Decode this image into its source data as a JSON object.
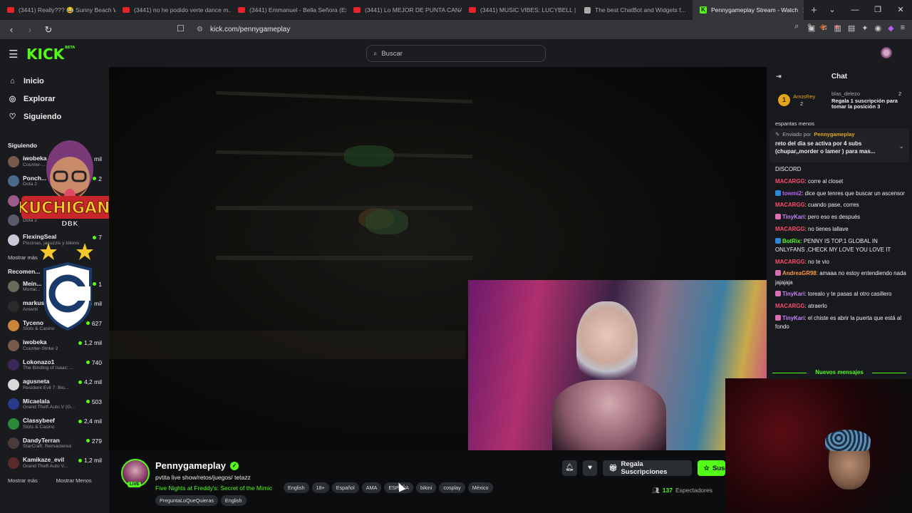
{
  "browser": {
    "tabs": [
      {
        "label": "(3441) Really??? 😂 Sunny Beach W...",
        "icon": "youtube"
      },
      {
        "label": "(3441) no he podido verte dance m...",
        "icon": "youtube"
      },
      {
        "label": "(3441) Emmanuel - Bella Señora (Ext...",
        "icon": "youtube"
      },
      {
        "label": "(3441) Lo MEJOR DE PUNTA CANA |",
        "icon": "youtube"
      },
      {
        "label": "(3441) MUSIC VIBES: LUCYBELL | by...",
        "icon": "youtube"
      },
      {
        "label": "The best ChatBot and Widgets f...",
        "icon": "generic"
      },
      {
        "label": "Pennygameplay Stream - Watch",
        "icon": "kick",
        "active": true
      }
    ],
    "new_tab": "+",
    "url": "kick.com/pennygameplay"
  },
  "topbar": {
    "logo": "KICK",
    "logo_badge": "BETA",
    "search_placeholder": "Buscar"
  },
  "sidebar": {
    "nav": [
      {
        "label": "Inicio",
        "icon": "home-icon"
      },
      {
        "label": "Explorar",
        "icon": "compass-icon"
      },
      {
        "label": "Siguiendo",
        "icon": "heart-icon"
      }
    ],
    "following_title": "Siguiendo",
    "following": [
      {
        "name": "iwobeka",
        "game": "Counter-...",
        "viewers": "mil",
        "color": "#7a5a4a"
      },
      {
        "name": "Ponch...",
        "game": "Dota 2",
        "viewers": "2",
        "color": "#4a6a8a"
      },
      {
        "name": "",
        "game": "",
        "viewers": "",
        "color": "#9a5a8a"
      },
      {
        "name": "",
        "game": "Dota 2",
        "viewers": "",
        "color": "#5a5a6a"
      },
      {
        "name": "FlexingSeal",
        "game": "Piscinas, jacuzzis y bikinis",
        "viewers": "7",
        "color": "#c9c9d9"
      }
    ],
    "following_more": "Mostrar más",
    "recommended_title": "Recomen...",
    "recommended": [
      {
        "name": "Mein...",
        "game": "Mortal...",
        "viewers": "1",
        "color": "#6a6a5a"
      },
      {
        "name": "markus...",
        "game": "Amenti",
        "viewers": "mil",
        "color": "#2a2a2a"
      },
      {
        "name": "Tyceno",
        "game": "Slots & Casino",
        "viewers": "627",
        "color": "#c9853a"
      },
      {
        "name": "iwobeka",
        "game": "Counter-Strike 2",
        "viewers": "1,2 mil",
        "color": "#7a5a4a"
      },
      {
        "name": "Lokonazo1",
        "game": "The Binding of Isaac: ...",
        "viewers": "740",
        "color": "#3a2a5a"
      },
      {
        "name": "agusneta",
        "game": "Resident Evil 7: Bio...",
        "viewers": "4,2 mil",
        "color": "#d9d9d9"
      },
      {
        "name": "Micaelala",
        "game": "Grand Theft Auto V (G...",
        "viewers": "503",
        "color": "#2a3a8a"
      },
      {
        "name": "Classybeef",
        "game": "Slots & Casino",
        "viewers": "2,4 mil",
        "color": "#2a8a3a"
      },
      {
        "name": "DandyTerran",
        "game": "StarCraft: Remastered",
        "viewers": "279",
        "color": "#4a3a3a"
      },
      {
        "name": "Kamikaze_evil",
        "game": "Grand Theft Auto V...",
        "viewers": "1,2 mil",
        "color": "#5a2a2a"
      }
    ],
    "rec_more": "Mostrar más",
    "rec_less": "Mostrar Menos"
  },
  "overlay": {
    "brand_line1": "KUCHIGANG",
    "brand_line2": "DBK"
  },
  "chat": {
    "title": "Chat",
    "leaderboard": {
      "rank": "1",
      "user1": "ArrosRey",
      "user1_count": "2",
      "user2": "blas_delezo",
      "user2_count": "2",
      "gift_text": "Regala 1 suscripción para tomar la posición 3"
    },
    "partial_text": "espantas menos",
    "pinned": {
      "sent_by": "Enviado por",
      "user": "Pennygameplay",
      "message": "reto del dia se activa por 4 subs (chupar,,morder o lamer ) para mas..."
    },
    "messages": [
      {
        "user": "",
        "text": "DISCORD",
        "color": "#e9e9ea",
        "icon": ""
      },
      {
        "user": "MACARGG",
        "text": ": corre al closet",
        "color": "#ff4b6e",
        "icon": ""
      },
      {
        "user": "towmi2",
        "text": ": dice que tenres que buscar un ascensor",
        "color": "#b665f5",
        "icon": "#2a8ad9"
      },
      {
        "user": "MACARGG",
        "text": ": cuando pase, corres",
        "color": "#ff4b6e",
        "icon": ""
      },
      {
        "user": "TinyKari",
        "text": ": pero eso es después",
        "color": "#c883ff",
        "icon": "#d96fb1"
      },
      {
        "user": "MACARGG",
        "text": ": no tienes lallave",
        "color": "#ff4b6e",
        "icon": ""
      },
      {
        "user": "BotRix",
        "text": ": PENNY IS TOP.1 GLOBAL IN ONLYFANS ,CHECK MY LOVE YOU LOVE IT",
        "color": "#53fc18",
        "icon": "#2a8ad9"
      },
      {
        "user": "MACARGG",
        "text": ": no te vio",
        "color": "#ff4b6e",
        "icon": ""
      },
      {
        "user": "AndreaGR98",
        "text": ": amaaa no estoy entendiendo nada jajajaja",
        "color": "#ff9a3c",
        "icon": "#d96fb1"
      },
      {
        "user": "TinyKari",
        "text": ": torealo y te pasas al otro casillero",
        "color": "#c883ff",
        "icon": "#d96fb1"
      },
      {
        "user": "MACARGG",
        "text": ": atraerlo",
        "color": "#ff4b6e",
        "icon": ""
      },
      {
        "user": "TinyKari",
        "text": ": el chiste es abrir la puerta que está al fondo",
        "color": "#c883ff",
        "icon": "#d96fb1"
      }
    ],
    "new_messages": "Nuevos mensajes"
  },
  "stream": {
    "channel": "Pennygameplay",
    "live": "LIVE",
    "title": "pvtita live show/retos/juegos/ tetazz",
    "game": "Five Nights at Freddy's: Secret of the Mimic",
    "tags": [
      "English",
      "18+",
      "Español",
      "AMA",
      "ESPAÑA",
      "bikini",
      "cosplay",
      "México"
    ],
    "tags2": [
      "PreguntaLoQueQuieras",
      "English"
    ],
    "gift_button": "Regala Suscripciones",
    "sub_button": "Suscribirse",
    "viewers": "137",
    "viewers_label": "Espectadores"
  },
  "colors": {
    "accent": "#53fc18",
    "bg": "#0b0d0f",
    "panel": "#191b1f"
  }
}
